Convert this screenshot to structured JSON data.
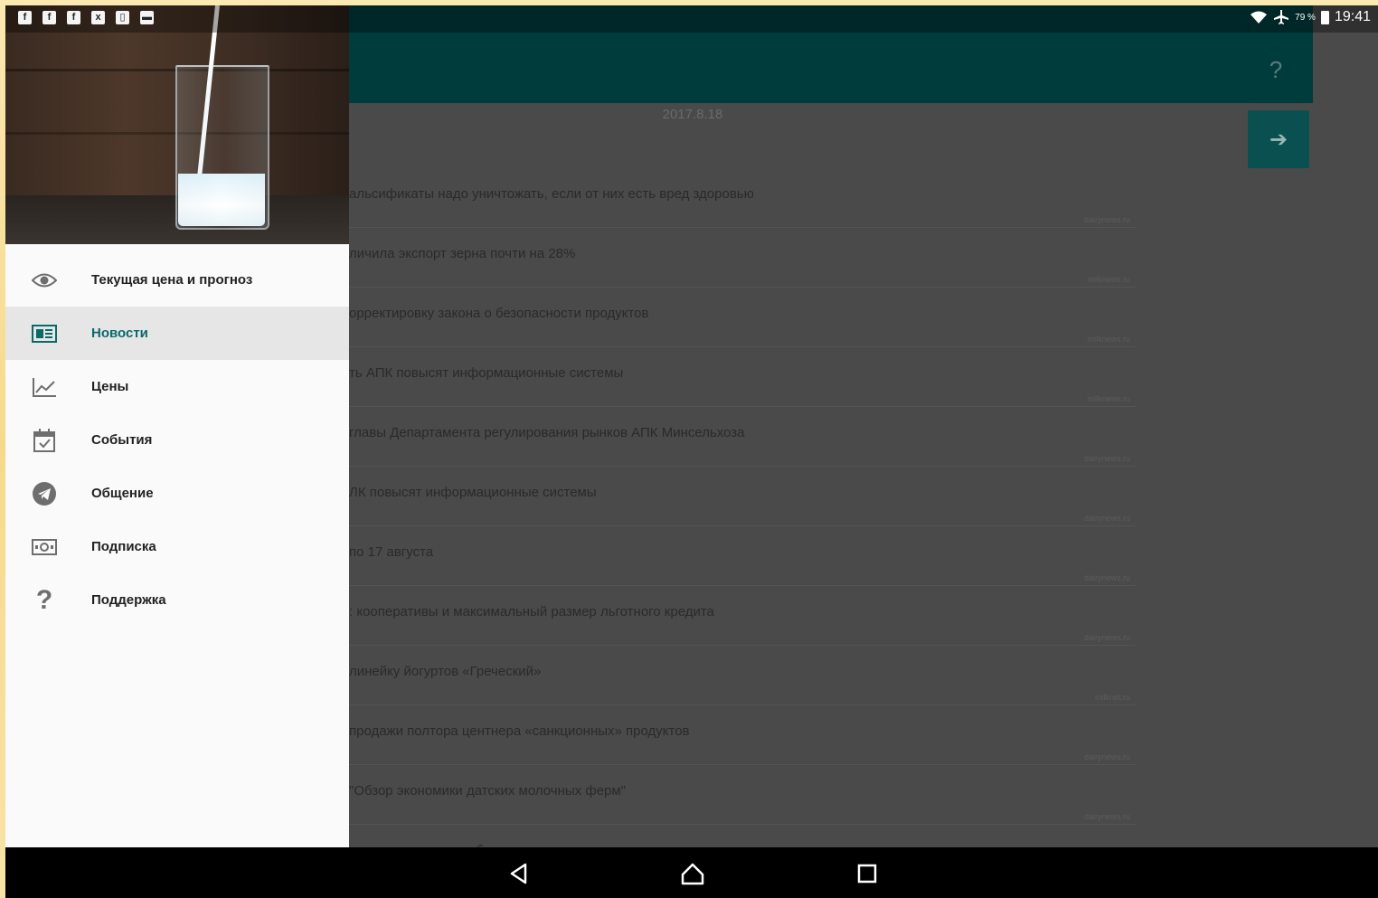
{
  "status_bar": {
    "notification_icons": [
      "f",
      "f",
      "f",
      "x",
      "▯",
      "▬"
    ],
    "battery_percent": "79 %",
    "time": "19:41"
  },
  "main": {
    "date": "2017.8.18",
    "help_glyph": "?",
    "news": [
      {
        "title": "альсификаты надо уничтожать, если от них есть вред здоровью",
        "source": "dairynews.ru"
      },
      {
        "title": "личила экспорт зерна почти на 28%",
        "source": "milknews.ru"
      },
      {
        "title": "орректировку закона о безопасности продуктов",
        "source": "milknews.ru"
      },
      {
        "title": "ть АПК повысят информационные системы",
        "source": "milknews.ru"
      },
      {
        "title": "главы Департамента регулирования рынков АПК Минсельхоза",
        "source": "dairynews.ru"
      },
      {
        "title": "ЛК повысят информационные системы",
        "source": "dairynews.ru"
      },
      {
        "title": "по 17 августа",
        "source": "dairynews.ru"
      },
      {
        "title": ": кооперативы и максимальный размер льготного кредита",
        "source": "dairynews.ru"
      },
      {
        "title": "линейку йогуртов «Греческий»",
        "source": "milknet.ru"
      },
      {
        "title": "продажи полтора центнера «санкционных» продуктов",
        "source": "dairynews.ru"
      },
      {
        "title": "\"Обзор экономики датских молочных ферм\"",
        "source": "dairynews.ru"
      },
      {
        "title": "ргового агента за рубежом",
        "source": ""
      }
    ]
  },
  "drawer": {
    "items": [
      {
        "label": "Текущая цена и прогноз",
        "icon": "eye-icon",
        "active": false
      },
      {
        "label": "Новости",
        "icon": "newspaper-icon",
        "active": true
      },
      {
        "label": "Цены",
        "icon": "trending-up-icon",
        "active": false
      },
      {
        "label": "События",
        "icon": "calendar-icon",
        "active": false
      },
      {
        "label": "Общение",
        "icon": "telegram-icon",
        "active": false
      },
      {
        "label": "Подписка",
        "icon": "money-icon",
        "active": false
      },
      {
        "label": "Поддержка",
        "icon": "question-icon",
        "active": false
      }
    ]
  },
  "colors": {
    "accent": "#0a6a6a",
    "appbar": "#003c3c",
    "fab": "#0b5050"
  }
}
